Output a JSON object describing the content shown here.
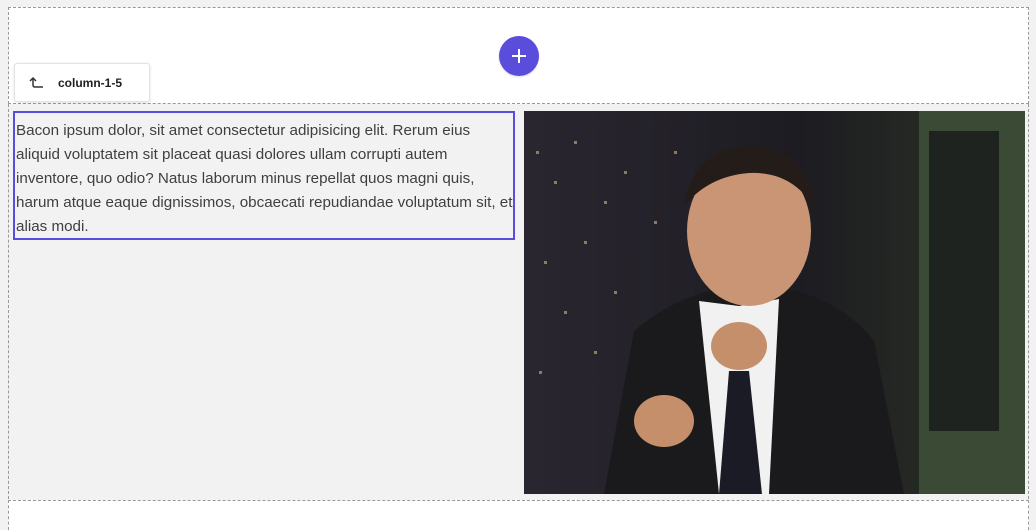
{
  "toolbar": {
    "breadcrumb_label": "column-1-5"
  },
  "content": {
    "paragraph": "Bacon ipsum dolor, sit amet consectetur adipisicing elit. Rerum eius aliquid voluptatem sit placeat quasi dolores ullam corrupti autem inventore, quo odio? Natus laborum minus repellat quos magni quis, harum atque eaque dignissimos, obcaecati repudiandae voluptatum sit, et alias modi."
  },
  "colors": {
    "accent": "#5b4ddb",
    "text": "#3f3f3f",
    "dashed_border": "#999999"
  },
  "icons": {
    "add": "plus-icon",
    "breadcrumb": "arrow-up-left-icon"
  }
}
